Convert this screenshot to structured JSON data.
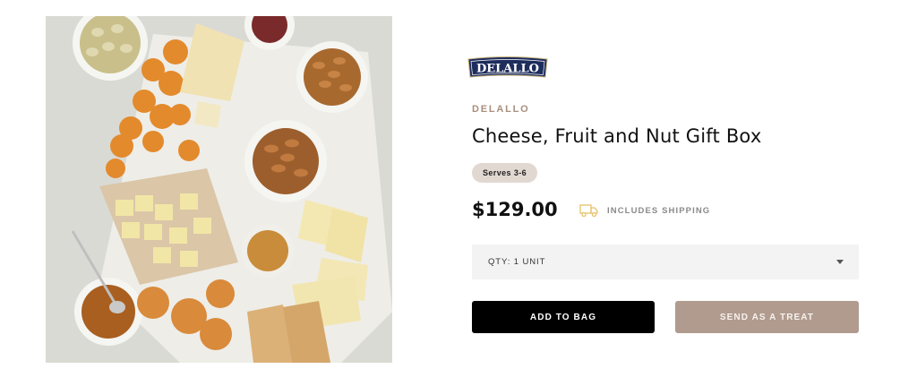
{
  "product": {
    "image_alt": "Cheese, fruit and nut board",
    "logo_text": "DELALLO",
    "brand": "DELALLO",
    "title": "Cheese, Fruit and Nut Gift Box",
    "serves_badge": "Serves 3-6",
    "price": "$129.00",
    "shipping_note": "INCLUDES SHIPPING",
    "shipping_icon": "truck-icon"
  },
  "quantity": {
    "selected": "QTY: 1 UNIT",
    "icon": "caret-down-icon"
  },
  "actions": {
    "add_to_bag": "ADD TO BAG",
    "send_as_treat": "SEND AS A TREAT"
  },
  "colors": {
    "brand_text": "#a88f7e",
    "badge_bg": "#e2d8d2",
    "add_button_bg": "#000000",
    "treat_button_bg": "#b09b8e",
    "select_bg": "#f3f3f3",
    "logo_navy": "#1e2d5c",
    "shipping_icon": "#e6c267"
  }
}
